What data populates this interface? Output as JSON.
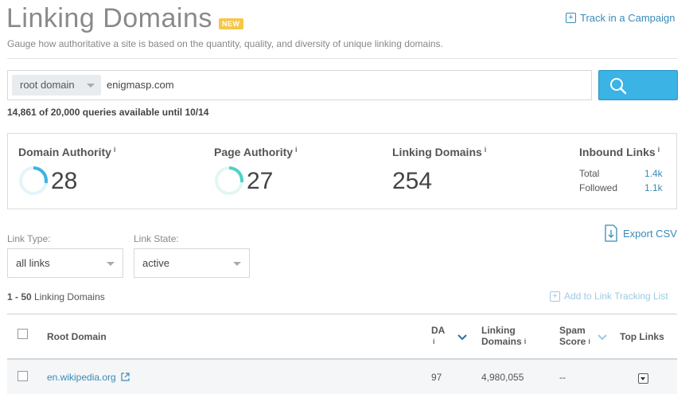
{
  "header": {
    "title": "Linking Domains",
    "badge": "NEW",
    "track_link": "Track in a Campaign",
    "subtitle": "Gauge how authoritative a site is based on the quantity, quality, and diversity of unique linking domains."
  },
  "search": {
    "scope_selected": "root domain",
    "query": "enigmasp.com",
    "quota_text": "14,861 of 20,000 queries available until 10/14"
  },
  "metrics": {
    "domain_authority": {
      "label": "Domain Authority",
      "info": "i",
      "value": "28",
      "gauge": 0.28
    },
    "page_authority": {
      "label": "Page Authority",
      "info": "i",
      "value": "27",
      "gauge": 0.27
    },
    "linking_domains": {
      "label": "Linking Domains",
      "info": "i",
      "value": "254"
    },
    "inbound_links": {
      "label": "Inbound Links",
      "info": "i",
      "total_label": "Total",
      "total_value": "1.4k",
      "followed_label": "Followed",
      "followed_value": "1.1k"
    }
  },
  "filters": {
    "link_type_label": "Link Type:",
    "link_type_value": "all links",
    "link_state_label": "Link State:",
    "link_state_value": "active",
    "export_label": "Export CSV"
  },
  "results": {
    "range": "1 - 50",
    "range_suffix": "Linking Domains",
    "add_tracking": "Add to Link Tracking List"
  },
  "table": {
    "columns": {
      "root_domain": "Root Domain",
      "da": "DA",
      "da_info": "i",
      "linking_domains_1": "Linking",
      "linking_domains_2": "Domains",
      "linking_info": "i",
      "spam_1": "Spam",
      "spam_2": "Score",
      "spam_info": "i",
      "top_links": "Top Links"
    },
    "rows": [
      {
        "domain": "en.wikipedia.org",
        "da": "97",
        "linking_domains": "4,980,055",
        "spam": "--"
      }
    ]
  },
  "colors": {
    "accent": "#3a8ab8",
    "search_button": "#3bb3e4",
    "gauge_da": "#3bb3e4",
    "gauge_pa": "#4fd1c5",
    "badge": "#f5c74a"
  }
}
